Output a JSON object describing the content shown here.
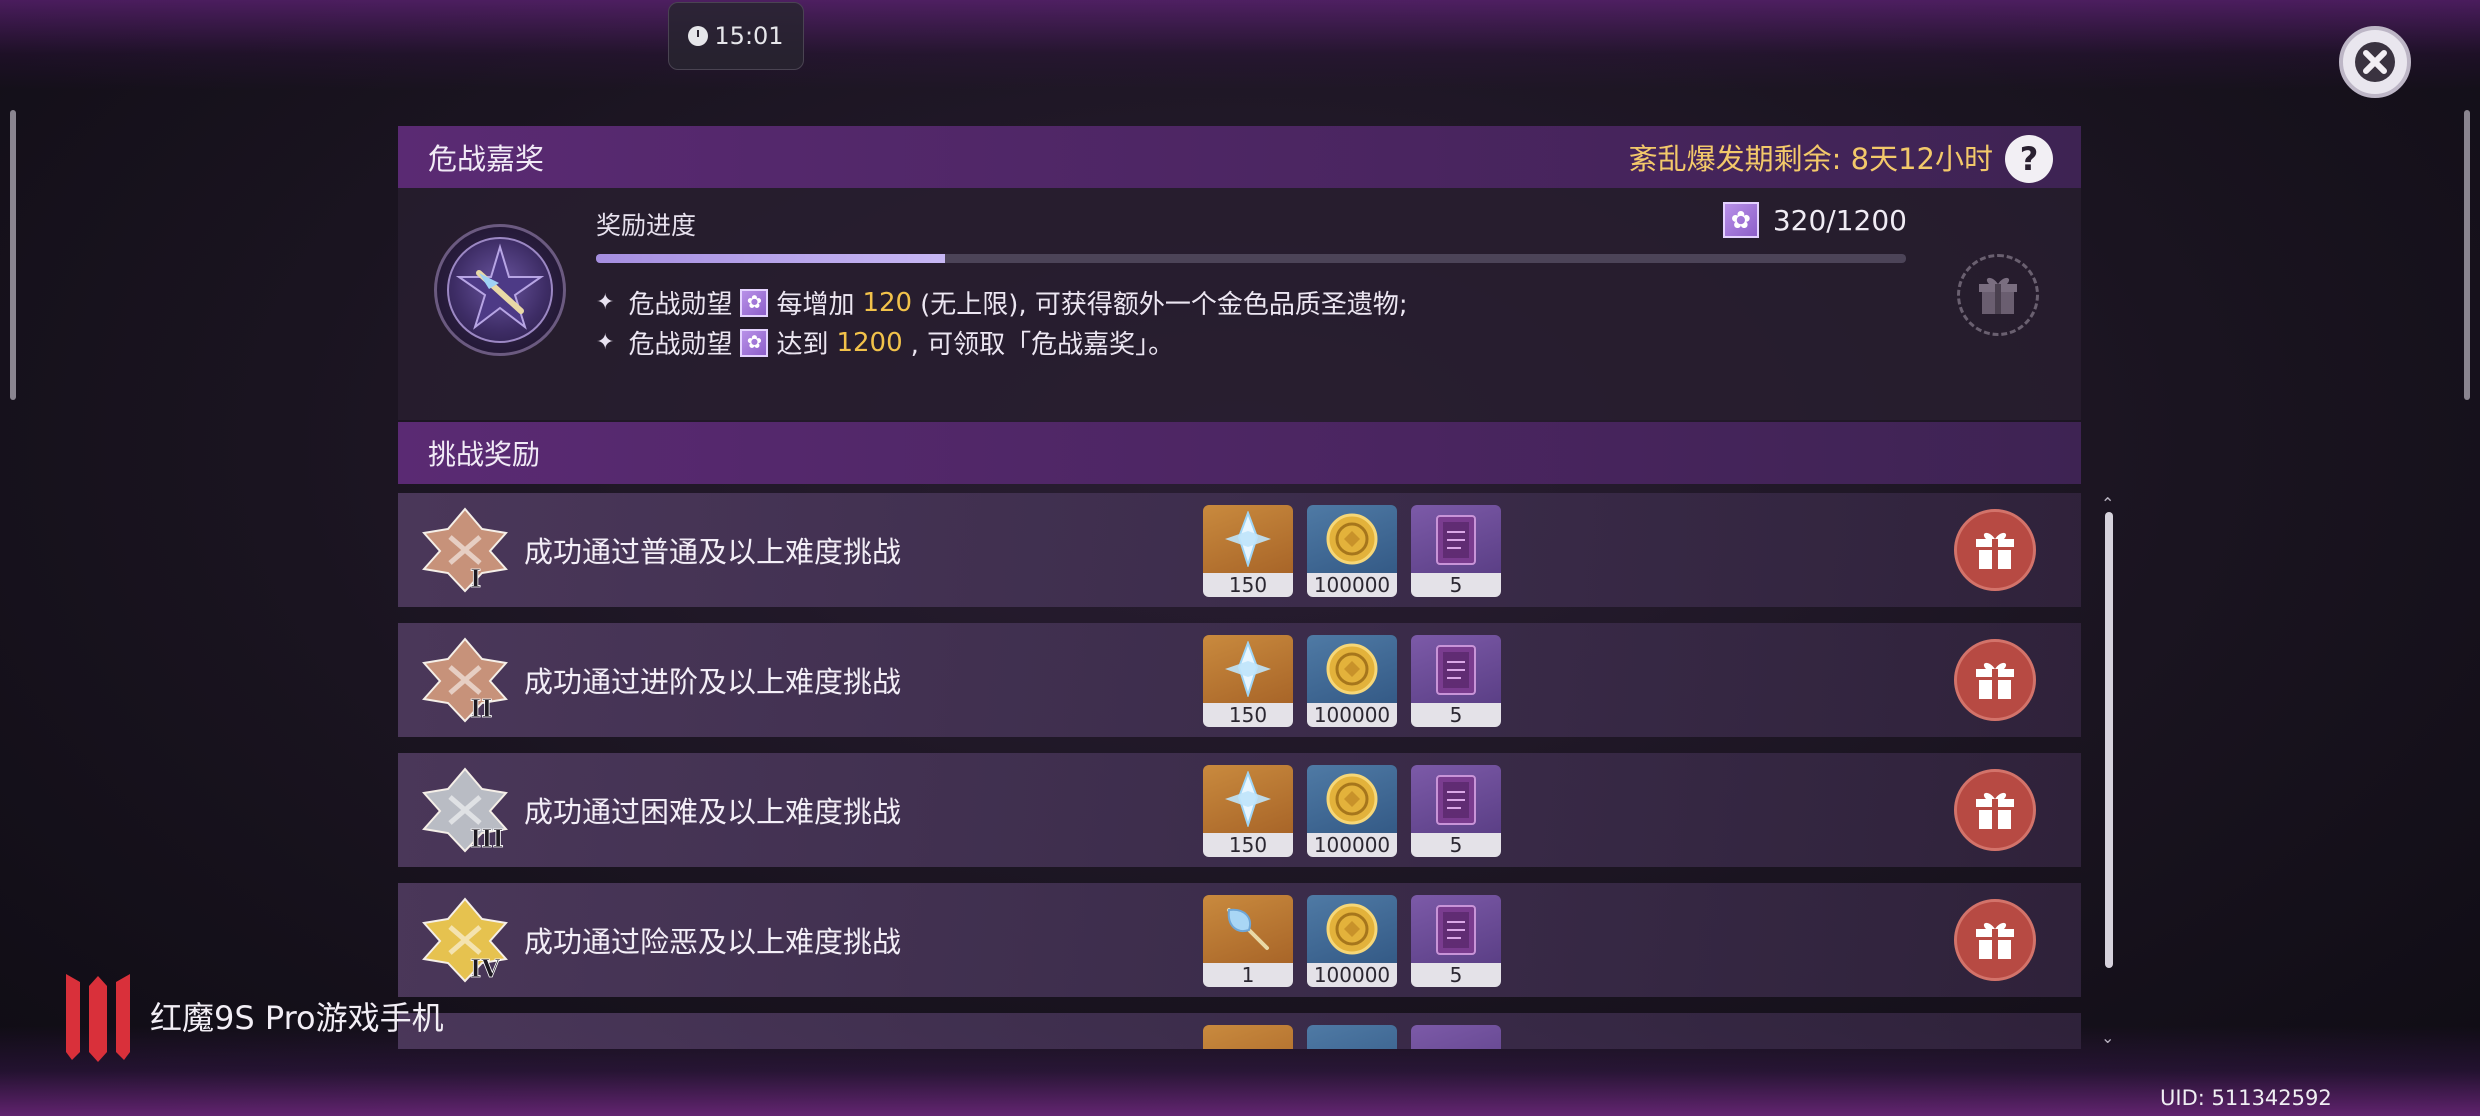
{
  "status": {
    "clock": "15:01"
  },
  "bonus_panel": {
    "title": "危战嘉奖",
    "timer": "紊乱爆发期剩余: 8天12小时",
    "help": "?",
    "progress_label": "奖励进度",
    "progress_count": "320/1200",
    "progress": {
      "current": 320,
      "max": 1200
    },
    "line1": {
      "a": "危战勋望",
      "b": "每增加",
      "hl": "120",
      "c": "(无上限), 可获得额外一个金色品质圣遗物;"
    },
    "line2": {
      "a": "危战勋望",
      "b": "达到",
      "hl": "1200",
      "c": ", 可领取「危战嘉奖」。"
    }
  },
  "challenge_section": {
    "title": "挑战奖励",
    "rows": [
      {
        "rank": "I",
        "rank_color": "#c7927a",
        "label": "成功通过普通及以上难度挑战",
        "items": [
          {
            "icon": "primogem-icon",
            "qty": "150"
          },
          {
            "icon": "mora-coin-icon",
            "qty": "100000"
          },
          {
            "icon": "exp-book-icon",
            "qty": "5"
          }
        ]
      },
      {
        "rank": "II",
        "rank_color": "#c7927a",
        "label": "成功通过进阶及以上难度挑战",
        "items": [
          {
            "icon": "primogem-icon",
            "qty": "150"
          },
          {
            "icon": "mora-coin-icon",
            "qty": "100000"
          },
          {
            "icon": "exp-book-icon",
            "qty": "5"
          }
        ]
      },
      {
        "rank": "III",
        "rank_color": "#b9bcc4",
        "label": "成功通过困难及以上难度挑战",
        "items": [
          {
            "icon": "primogem-icon",
            "qty": "150"
          },
          {
            "icon": "mora-coin-icon",
            "qty": "100000"
          },
          {
            "icon": "exp-book-icon",
            "qty": "5"
          }
        ]
      },
      {
        "rank": "IV",
        "rank_color": "#e6c24f",
        "label": "成功通过险恶及以上难度挑战",
        "items": [
          {
            "icon": "artifact-feather-icon",
            "qty": "1"
          },
          {
            "icon": "mora-coin-icon",
            "qty": "100000"
          },
          {
            "icon": "exp-book-icon",
            "qty": "5"
          }
        ]
      }
    ]
  },
  "watermark": "红魔9S Pro游戏手机",
  "uid": "UID: 511342592",
  "colors": {
    "accent_gold": "#f2c24a",
    "header_purple": "#5a2a73",
    "gift_red": "#b74a43"
  }
}
